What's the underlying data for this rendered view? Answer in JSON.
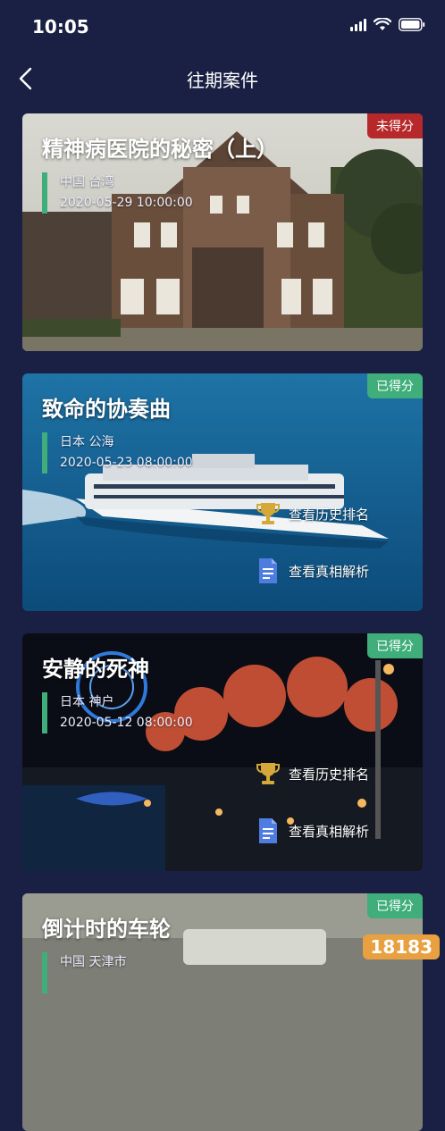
{
  "status": {
    "time": "10:05"
  },
  "nav": {
    "title": "往期案件"
  },
  "cards": [
    {
      "title": "精神病医院的秘密（上）",
      "badge": "未得分",
      "badge_color": "#b7282a",
      "location": "中国 台湾",
      "datetime": "2020-05-29 10:00:00"
    },
    {
      "title": "致命的协奏曲",
      "badge": "已得分",
      "badge_color": "#3fae7a",
      "location": "日本 公海",
      "datetime": "2020-05-23 08:00:00",
      "rank_label": "查看历史排名",
      "answer_label": "查看真相解析"
    },
    {
      "title": "安静的死神",
      "badge": "已得分",
      "badge_color": "#3fae7a",
      "location": "日本 神户",
      "datetime": "2020-05-12 08:00:00",
      "rank_label": "查看历史排名",
      "answer_label": "查看真相解析"
    },
    {
      "title": "倒计时的车轮",
      "badge": "已得分",
      "badge_color": "#3fae7a",
      "location": "中国 天津市"
    }
  ],
  "watermark": "18183",
  "icons": {
    "back": "chevron-left-icon",
    "trophy": "trophy-icon",
    "document": "document-icon"
  }
}
